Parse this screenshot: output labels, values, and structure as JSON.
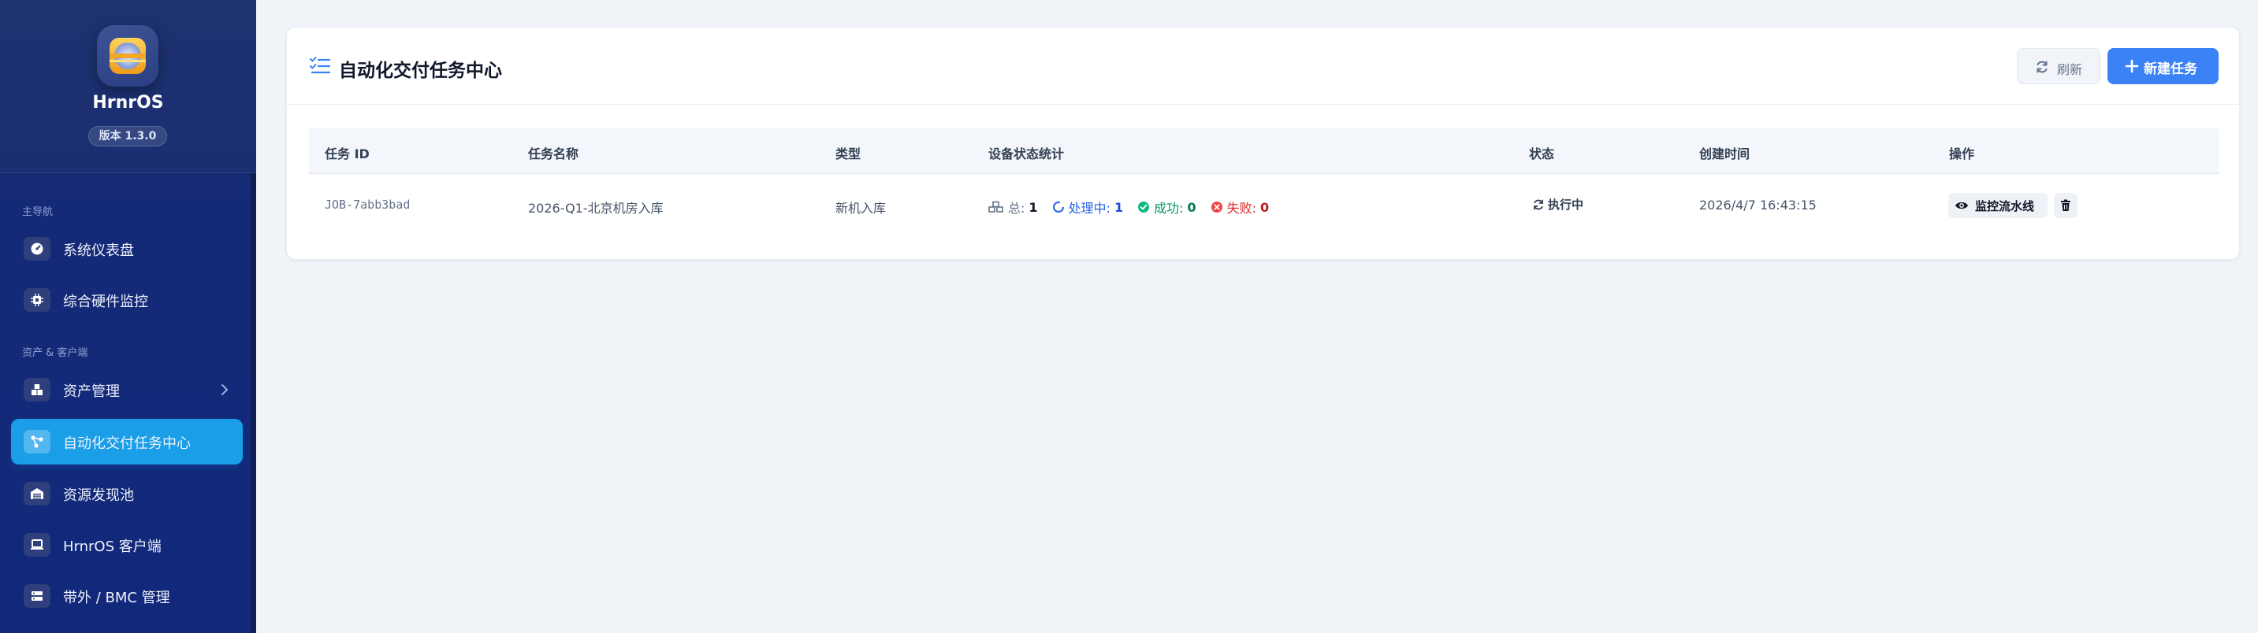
{
  "app": {
    "name": "HrnrOS",
    "version": "版本 1.3.0"
  },
  "sidebar": {
    "sections": [
      {
        "label": "主导航"
      },
      {
        "label": "资产 & 客户端"
      }
    ],
    "items": [
      {
        "label": "系统仪表盘",
        "icon": "dashboard-icon"
      },
      {
        "label": "综合硬件监控",
        "icon": "chip-icon"
      },
      {
        "label": "资产管理",
        "icon": "boxes-icon"
      },
      {
        "label": "自动化交付任务中心",
        "icon": "workflow-icon",
        "active": true
      },
      {
        "label": "资源发现池",
        "icon": "warehouse-icon"
      },
      {
        "label": "HrnrOS 客户端",
        "icon": "laptop-icon"
      },
      {
        "label": "带外 / BMC 管理",
        "icon": "server-icon"
      }
    ]
  },
  "page": {
    "title": "自动化交付任务中心",
    "refresh_label": "刷新",
    "new_task_label": "新建任务"
  },
  "table": {
    "headers": [
      "任务 ID",
      "任务名称",
      "类型",
      "设备状态统计",
      "状态",
      "创建时间",
      "操作"
    ],
    "rows": [
      {
        "id": "JOB-7abb3bad",
        "name": "2026-Q1-北京机房入库",
        "type": "新机入库",
        "stats": {
          "total_label": "总:",
          "total": "1",
          "processing_label": "处理中:",
          "processing": "1",
          "success_label": "成功:",
          "success": "0",
          "failed_label": "失败:",
          "failed": "0"
        },
        "status": "执行中",
        "created_at": "2026/4/7 16:43:15",
        "monitor_label": "监控流水线"
      }
    ]
  },
  "colors": {
    "accent": "#3b82f6",
    "active_nav": "#1a9ee8",
    "sidebar_bg": "#142a78",
    "success": "#059669",
    "failed": "#dc2626"
  }
}
